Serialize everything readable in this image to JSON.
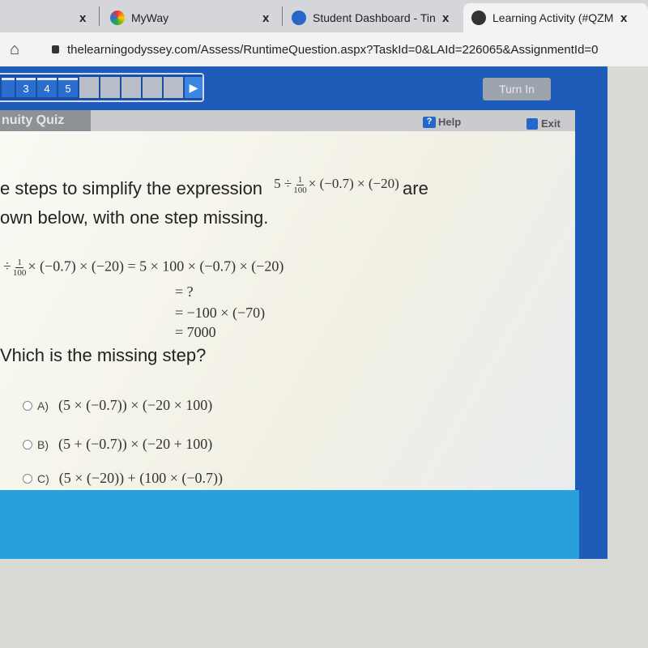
{
  "browser": {
    "tabs": [
      {
        "label": "",
        "icon": "tab-close"
      },
      {
        "label": "MyWay",
        "icon": "myway-logo-icon"
      },
      {
        "label": "Student Dashboard - Tin",
        "icon": "odyssey-logo-icon"
      },
      {
        "label": "Learning Activity (#QZM",
        "icon": "globe-icon"
      }
    ],
    "close_glyph": "x",
    "url": "thelearningodyssey.com/Assess/RuntimeQuestion.aspx?TaskId=0&LAId=226065&AssignmentId=0"
  },
  "toolbar": {
    "pages": [
      "3",
      "4",
      "5"
    ],
    "next_glyph": "▶",
    "turn_in": "Turn In"
  },
  "quiz": {
    "title": "nuity Quiz",
    "help": "Help",
    "exit": "Exit",
    "prompt_line1": "e steps to simplify the expression",
    "prompt_expr_pre": "5 ÷",
    "prompt_expr_num": "1",
    "prompt_expr_den": "100",
    "prompt_expr_post": "× (−0.7) × (−20)",
    "prompt_line1_end": "are",
    "prompt_line2": "own below, with one step missing.",
    "steps": {
      "first_pre": "÷",
      "first_num": "1",
      "first_den": "100",
      "first_post": "× (−0.7) × (−20) = 5 × 100 × (−0.7) × (−20)",
      "step2": "= ?",
      "step3": "= −100 × (−70)",
      "step4": "= 7000"
    },
    "question": "Vhich is the missing step?",
    "options": [
      {
        "label": "A)",
        "value": "(5 × (−0.7)) × (−20 × 100)"
      },
      {
        "label": "B)",
        "value": "(5 + (−0.7)) × (−20 + 100)"
      },
      {
        "label": "C)",
        "value": "(5 × (−20)) + (100 × (−0.7))"
      }
    ]
  },
  "colors": {
    "toolbar": "#1f5bb8",
    "footer": "#29a0dc",
    "header_gray": "#c9cbce"
  }
}
